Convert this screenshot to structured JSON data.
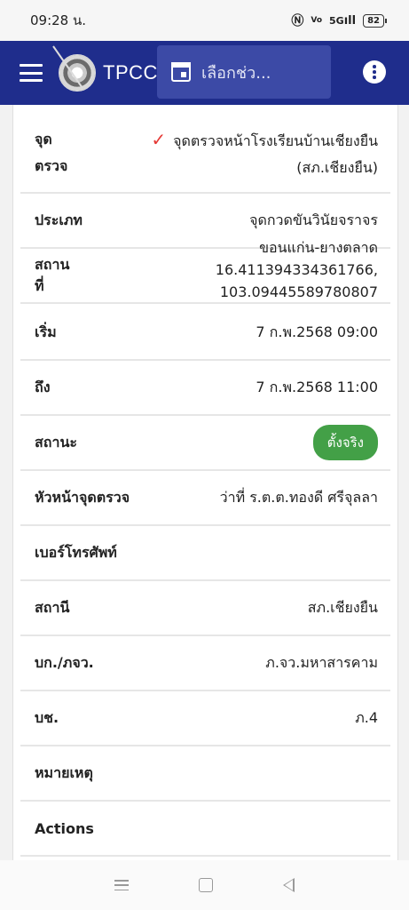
{
  "status_bar": {
    "time": "09:28 น.",
    "signal_text": "5G",
    "battery": "82"
  },
  "appbar": {
    "title": "TPCC",
    "date_placeholder": "เลือกช่ว..."
  },
  "details": {
    "checkpoint_label": "จุดตรวจ",
    "checkpoint_label_l1": "จุด",
    "checkpoint_label_l2": "ตรวจ",
    "checkpoint_value_l1": "จุดตรวจหน้าโรงเรียนบ้านเชียงยืน",
    "checkpoint_value_l2": "(สภ.เชียงยืน)",
    "type_label": "ประเภท",
    "type_value": "จุดกวดขันวินัยจราจร",
    "place_label_l1": "สถาน",
    "place_label_l2": "ที่",
    "place_value_l1": "ขอนแก่น-ยางตลาด",
    "place_value_l2": "16.411394334361766,",
    "place_value_l3": "103.09445589780807",
    "start_label": "เริ่ม",
    "start_value": "7 ก.พ.2568 09:00",
    "end_label": "ถึง",
    "end_value": "7 ก.พ.2568 11:00",
    "status_label": "สถานะ",
    "status_value": "ตั้งจริง",
    "chief_label": "หัวหน้าจุดตรวจ",
    "chief_value": "ว่าที่ ร.ต.ต.ทองดี ศรีจุลลา",
    "phone_label": "เบอร์โทรศัพท์",
    "phone_value": "",
    "station_label": "สถานี",
    "station_value": "สภ.เชียงยืน",
    "command_label": "บก./ภจว.",
    "command_value": "ภ.จว.มหาสารคาม",
    "bureau_label": "บช.",
    "bureau_value": "ภ.4",
    "remark_label": "หมายเหตุ",
    "remark_value": "",
    "actions_label": "Actions"
  },
  "colors": {
    "appbar": "#1f2d8c",
    "status_pill": "#43a047",
    "check": "#e53935"
  }
}
